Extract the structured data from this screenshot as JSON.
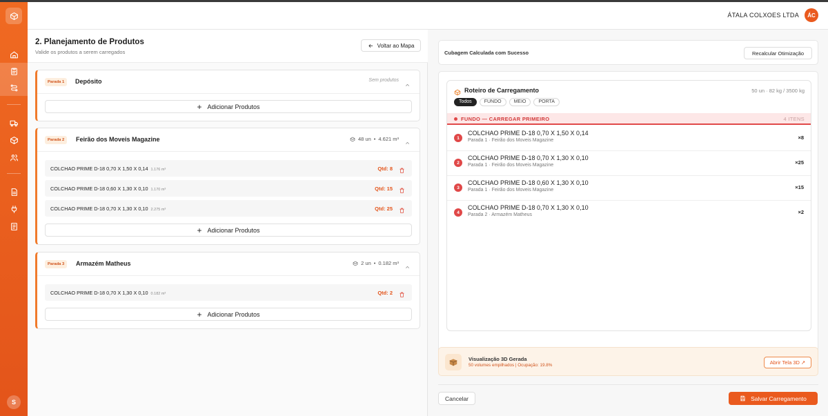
{
  "header": {
    "company": "ÁTALA COLXOES LTDA",
    "avatar_initials": "ÁC"
  },
  "sidebar": {
    "user_initial": "S",
    "items": [
      "home-icon",
      "clipboard-icon",
      "route-icon",
      "truck-icon",
      "box-icon",
      "users-icon",
      "file-icon",
      "plug-icon",
      "report-icon"
    ]
  },
  "planning": {
    "title": "2. Planejamento de Produtos",
    "subtitle": "Valide os produtos a serem carregados",
    "back_label": "Voltar ao Mapa",
    "add_label": "Adicionar Produtos",
    "stops": [
      {
        "badge": "Parada 1",
        "name": "Depósito",
        "empty_text": "Sem produtos",
        "units": "",
        "volume": "",
        "products": []
      },
      {
        "badge": "Parada 2",
        "name": "Feirão dos Moveis Magazine",
        "empty_text": "",
        "units": "48 un",
        "volume": "4.621 m³",
        "products": [
          {
            "name": "COLCHAO PRIME D-18 0,70 X 1,50 X 0,14",
            "volume": "1.176 m³",
            "qty": "Qtd: 8"
          },
          {
            "name": "COLCHAO PRIME D-18 0,60 X 1,30 X 0,10",
            "volume": "1.170 m³",
            "qty": "Qtd: 15"
          },
          {
            "name": "COLCHAO PRIME D-18 0,70 X 1,30 X 0,10",
            "volume": "2.275 m³",
            "qty": "Qtd: 25"
          }
        ]
      },
      {
        "badge": "Parada 3",
        "name": "Armazém Matheus",
        "empty_text": "",
        "units": "2 un",
        "volume": "0.182 m³",
        "products": [
          {
            "name": "COLCHAO PRIME D-18 0,70 X 1,30 X 0,10",
            "volume": "0.182 m³",
            "qty": "Qtd: 2"
          }
        ]
      }
    ]
  },
  "loading": {
    "status": "Cubagem Calculada com Sucesso",
    "recalc_label": "Recalcular Otimização",
    "route_title": "Roteiro de Carregamento",
    "route_meta": "50 un · 82 kg / 3500 kg",
    "filters": [
      "Todos",
      "FUNDO",
      "MEIO",
      "PORTA"
    ],
    "section_label": "FUNDO — CARREGAR PRIMEIRO",
    "section_count": "4 ITENS",
    "items": [
      {
        "num": "1",
        "name": "COLCHAO PRIME D-18 0,70 X 1,50 X 0,14",
        "sub": "Parada 1 · Feirão dos Moveis Magazine",
        "qty": "×8"
      },
      {
        "num": "2",
        "name": "COLCHAO PRIME D-18 0,70 X 1,30 X 0,10",
        "sub": "Parada 1 · Feirão dos Moveis Magazine",
        "qty": "×25"
      },
      {
        "num": "3",
        "name": "COLCHAO PRIME D-18 0,60 X 1,30 X 0,10",
        "sub": "Parada 1 · Feirão dos Moveis Magazine",
        "qty": "×15"
      },
      {
        "num": "4",
        "name": "COLCHAO PRIME D-18 0,70 X 1,30 X 0,10",
        "sub": "Parada 2 · Armazém Matheus",
        "qty": "×2"
      }
    ],
    "viz_title": "Visualização 3D Gerada",
    "viz_sub": "50 volumes empilhados | Ocupação: 19.8%",
    "viz_btn": "Abrir Tela 3D ↗",
    "cancel_label": "Cancelar",
    "save_label": "Salvar Carregamento"
  },
  "colors": {
    "accent": "#ea5a1e",
    "danger": "#e04848"
  }
}
